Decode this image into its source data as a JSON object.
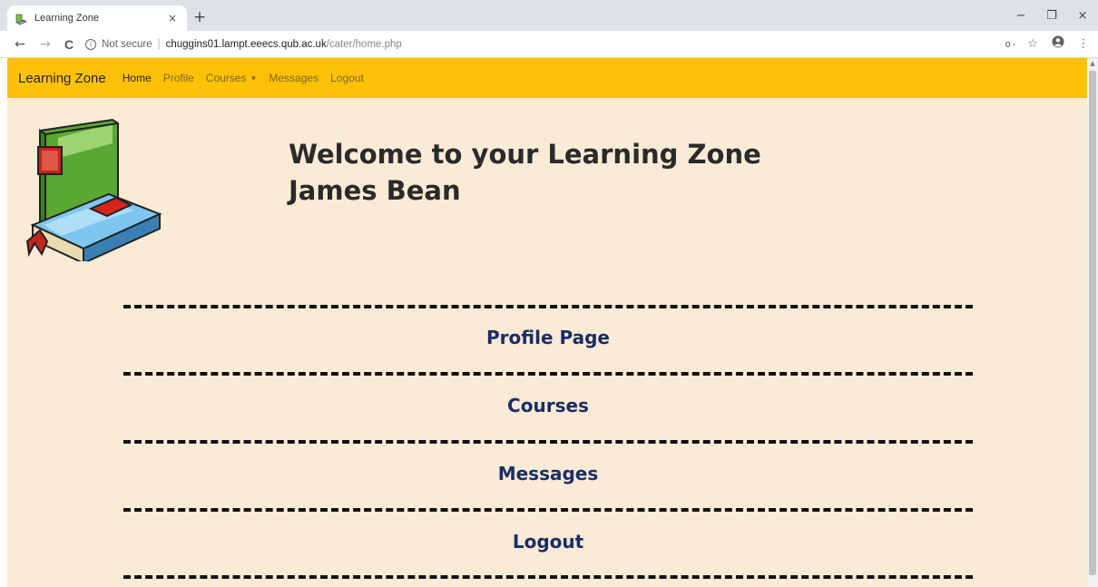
{
  "browser": {
    "tab_title": "Learning Zone",
    "tab_close": "×",
    "new_tab": "+",
    "back": "←",
    "forward": "→",
    "reload": "C",
    "not_secure": "Not secure",
    "separator": "|",
    "url_host": "chuggins01.lampt.eeecs.qub.ac.uk",
    "url_path": "/cater/home.php",
    "minimize": "−",
    "restore": "❐",
    "close": "×",
    "key_icon": "o-",
    "star_icon": "☆",
    "menu_icon": "⋮"
  },
  "navbar": {
    "brand": "Learning Zone",
    "links": [
      {
        "label": "Home",
        "active": true
      },
      {
        "label": "Profile"
      },
      {
        "label": "Courses",
        "dropdown": true
      },
      {
        "label": "Messages"
      },
      {
        "label": "Logout"
      }
    ],
    "color": "#ffc107"
  },
  "page": {
    "welcome_line1": "Welcome to your Learning Zone",
    "welcome_line2": "James Bean",
    "background": "#faebd7",
    "sections": [
      {
        "label": "Profile Page"
      },
      {
        "label": "Courses"
      },
      {
        "label": "Messages"
      },
      {
        "label": "Logout"
      }
    ]
  }
}
